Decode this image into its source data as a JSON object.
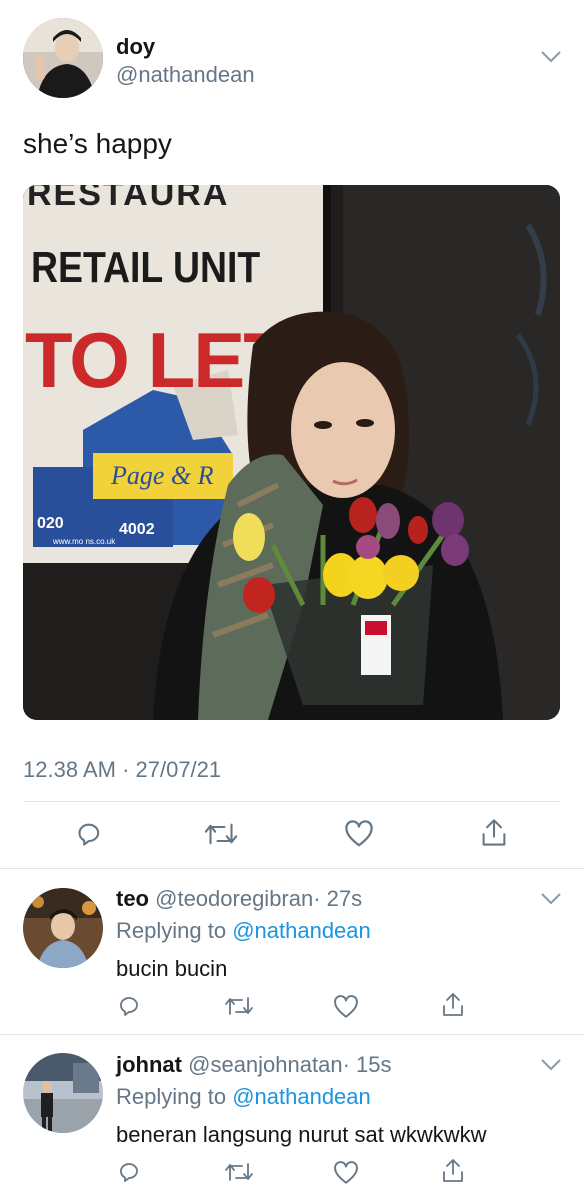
{
  "tweet": {
    "author_name": "doy",
    "author_handle": "@nathandean",
    "text": "she’s happy",
    "timestamp": "12.38 AM · 27/07/21",
    "photo": {
      "sign_line1": "RETAIL UNIT",
      "sign_line2": "TO LET",
      "sign_line3": "Page & R",
      "sign_phone1": "020",
      "sign_phone2": "4002",
      "sign_web": "www.mo  ns.co.uk"
    }
  },
  "actions": {
    "reply": "reply-icon",
    "retweet": "retweet-icon",
    "like": "heart-icon",
    "share": "share-icon"
  },
  "replies": [
    {
      "name": "teo",
      "handle": "@teodoregibran",
      "time": "· 27s",
      "replying_prefix": "Replying to",
      "replying_to": "@nathandean",
      "text": "bucin bucin"
    },
    {
      "name": "johnat",
      "handle": "@seanjohnatan",
      "time": "· 15s",
      "replying_prefix": "Replying to",
      "replying_to": "@nathandean",
      "text": "beneran langsung nurut sat wkwkwkw"
    }
  ],
  "colors": {
    "text": "#14171a",
    "secondary": "#657786",
    "accent": "#1b95e0",
    "divider": "#e1e8ed"
  }
}
